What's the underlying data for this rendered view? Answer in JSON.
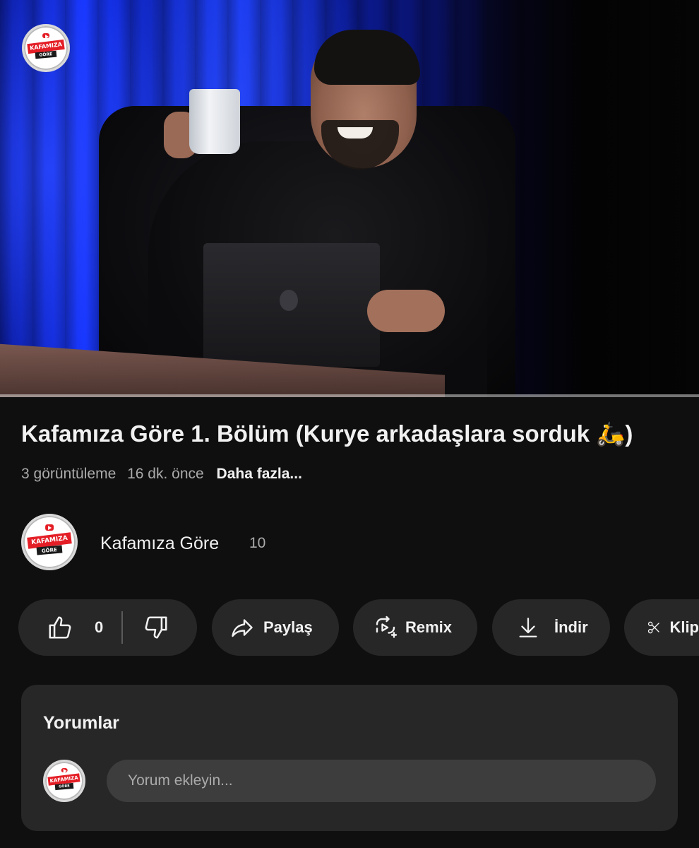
{
  "video": {
    "channel_logo_text_top": "KAFAMIZA",
    "channel_logo_text_bottom": "GÖRE",
    "progress": 0.0
  },
  "title": "Kafamıza Göre 1. Bölüm (Kurye arkadaşlara sorduk 🛵)",
  "meta": {
    "views": "3 görüntüleme",
    "time": "16 dk. önce",
    "more": "Daha fazla..."
  },
  "channel": {
    "name": "Kafamıza Göre",
    "subscribers": "10",
    "avatar_text_top": "KAFAMIZA",
    "avatar_text_bottom": "GÖRE"
  },
  "actions": {
    "like_count": "0",
    "share_label": "Paylaş",
    "remix_label": "Remix",
    "download_label": "İndir",
    "clip_label": "Klip"
  },
  "comments": {
    "header": "Yorumlar",
    "placeholder": "Yorum ekleyin...",
    "avatar_text_top": "KAFAMIZA",
    "avatar_text_bottom": "GÖRE"
  },
  "colors": {
    "background": "#0f0f0f",
    "pill": "#272727",
    "text": "#f1f1f1",
    "secondary_text": "#aaaaaa",
    "brand_red": "#e41e26"
  }
}
